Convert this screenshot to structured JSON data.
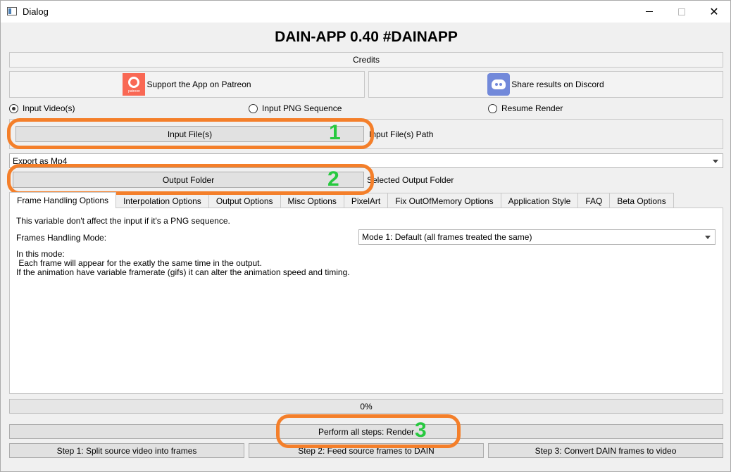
{
  "window": {
    "title": "Dialog",
    "close_glyph": "✕"
  },
  "app": {
    "heading": "DAIN-APP 0.40 #DAINAPP"
  },
  "buttons": {
    "credits": "Credits",
    "patreon": "Support the App on Patreon",
    "patreon_logo_text": "patreon",
    "discord": "Share results on Discord",
    "input_files": "Input File(s)",
    "output_folder": "Output Folder",
    "render_all": "Perform all steps: Render",
    "step1": "Step 1: Split source video into frames",
    "step2": "Step 2: Feed source frames to DAIN",
    "step3": "Step 3: Convert DAIN frames to video"
  },
  "input_mode": {
    "options": [
      "Input Video(s)",
      "Input PNG Sequence",
      "Resume Render"
    ],
    "selected_index": 0
  },
  "paths": {
    "input_path_label": "Input File(s) Path",
    "output_path_label": "Selected Output Folder"
  },
  "export": {
    "selected": "Export as Mp4"
  },
  "tabs": [
    "Frame Handling Options",
    "Interpolation Options",
    "Output Options",
    "Misc Options",
    "PixelArt",
    "Fix OutOfMemory Options",
    "Application Style",
    "FAQ",
    "Beta Options"
  ],
  "frame_handling": {
    "note": "This variable don't affect the input if it's a PNG sequence.",
    "mode_label": "Frames Handling Mode:",
    "mode_selected": "Mode 1: Default (all frames treated the same)",
    "description_lines": [
      "In this mode:",
      " Each frame will appear for the exatly the same time in the output.",
      "If the animation have variable framerate (gifs) it can alter the animation speed and timing."
    ]
  },
  "progress": {
    "percent": 0,
    "text": "0%"
  },
  "annotations": {
    "numbers": [
      "1",
      "2",
      "3"
    ],
    "color": "#f47f2a",
    "number_color": "#27c93f"
  }
}
